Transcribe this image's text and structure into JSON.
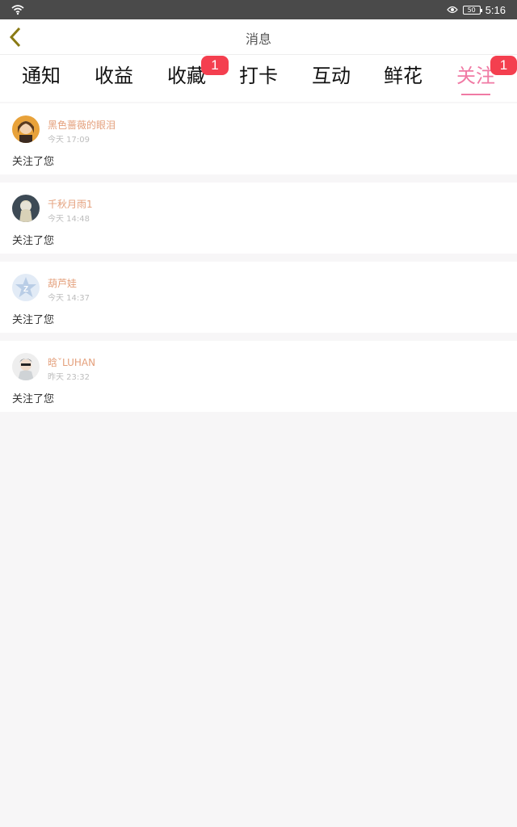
{
  "status_bar": {
    "battery": "50",
    "time": "5:16",
    "icons": [
      "wifi-icon",
      "eye-icon",
      "battery-icon"
    ]
  },
  "header": {
    "title": "消息",
    "back_icon": "chevron-left-icon"
  },
  "colors": {
    "accent": "#f07aa4",
    "badge": "#f43f4f",
    "username": "#e4a07c",
    "back_arrow": "#8a7a14"
  },
  "tabs": [
    {
      "label": "通知",
      "badge": ""
    },
    {
      "label": "收益",
      "badge": ""
    },
    {
      "label": "收藏",
      "badge": "1"
    },
    {
      "label": "打卡",
      "badge": ""
    },
    {
      "label": "互动",
      "badge": ""
    },
    {
      "label": "鲜花",
      "badge": ""
    },
    {
      "label": "关注",
      "badge": "1",
      "active": true
    }
  ],
  "messages": [
    {
      "username": "黑色蔷薇的眼泪",
      "time": "今天 17:09",
      "text": "关注了您"
    },
    {
      "username": "千秋月雨1",
      "time": "今天 14:48",
      "text": "关注了您"
    },
    {
      "username": "葫芦娃",
      "time": "今天 14:37",
      "text": "关注了您"
    },
    {
      "username": "晗ˇLUHAN",
      "time": "昨天 23:32",
      "text": "关注了您"
    }
  ]
}
